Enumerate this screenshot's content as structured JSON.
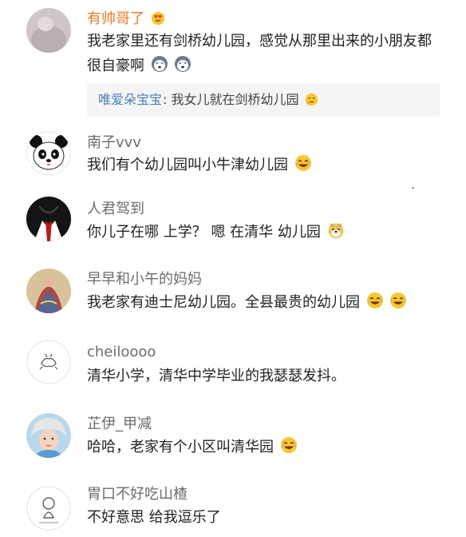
{
  "comments": [
    {
      "username": "有帅哥了",
      "text": "我老家里还有剑桥幼儿园，感觉从那里出来的小朋友都很自豪啊",
      "reply": {
        "user": "唯爱朵宝宝",
        "text": ": 我女儿就在剑桥幼儿园"
      }
    },
    {
      "username": "南子vvv",
      "text": "我们有个幼儿园叫小牛津幼儿园"
    },
    {
      "username": "人君驾到",
      "text": "你儿子在哪 上学？ 嗯 在清华 幼儿园"
    },
    {
      "username": "早早和小午的妈妈",
      "text": "我老家有迪士尼幼儿园。全县最贵的幼儿园"
    },
    {
      "username": "cheiloooo",
      "text": "清华小学，清华中学毕业的我瑟瑟发抖。"
    },
    {
      "username": "芷伊_甲减",
      "text": "哈哈，老家有个小区叫清华园"
    },
    {
      "username": "胃口不好吃山楂",
      "text": "不好意思 给我逗乐了"
    }
  ],
  "colors": {
    "vip_username": "#ec7a1e",
    "username": "#6b6b6b",
    "reply_user": "#4d7fb3",
    "text": "#222222"
  },
  "icons": [
    "heart-eyes-emoji",
    "husky-emoji",
    "laugh-cry-emoji",
    "doge-emoji",
    "thinking-emoji"
  ]
}
